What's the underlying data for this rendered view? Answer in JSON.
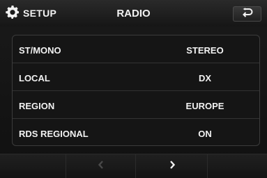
{
  "header": {
    "setup_label": "SETUP",
    "title": "RADIO"
  },
  "settings": [
    {
      "label": "ST/MONO",
      "value": "STEREO"
    },
    {
      "label": "LOCAL",
      "value": "DX"
    },
    {
      "label": "REGION",
      "value": "EUROPE"
    },
    {
      "label": "RDS REGIONAL",
      "value": "ON"
    }
  ],
  "icons": {
    "setup": "gear-icon",
    "back": "return-arrow-icon",
    "prev": "chevron-left-icon",
    "next": "chevron-right-icon"
  },
  "pagination": {
    "prev_enabled": false,
    "next_enabled": true
  },
  "colors": {
    "text": "#f2f2f2",
    "disabled_icon": "#4a4a4a",
    "background": "#151515"
  }
}
